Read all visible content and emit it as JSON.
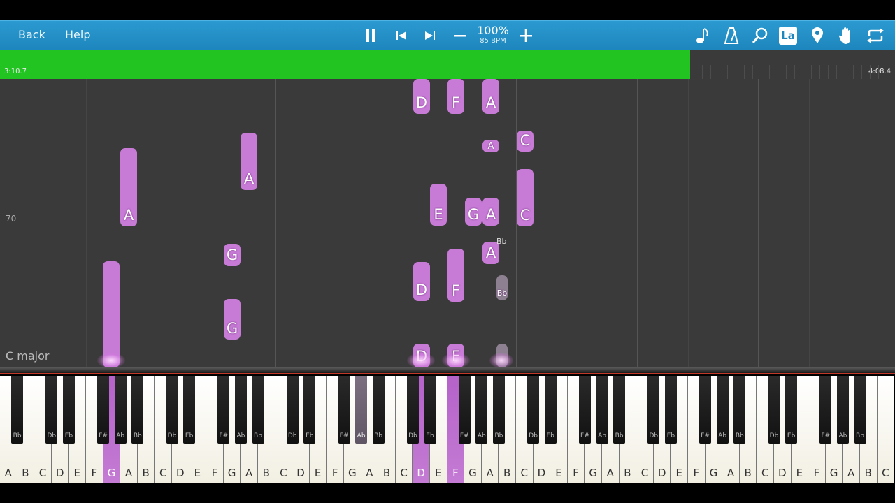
{
  "toolbar": {
    "back_label": "Back",
    "help_label": "Help",
    "speed_percent": "100%",
    "bpm": "85 BPM",
    "icons": [
      "pause-icon",
      "previous-icon",
      "next-icon",
      "minus-icon",
      "plus-icon",
      "music-note-icon",
      "metronome-icon",
      "search-icon",
      "label-icon",
      "location-pin-icon",
      "hand-icon",
      "loop-icon"
    ],
    "label_icon_text": "La"
  },
  "progress": {
    "current_time": "3:10.7",
    "total_time": "4:08.4",
    "fraction": 0.771,
    "fill_color": "#22c422"
  },
  "roll": {
    "measure_label": "70",
    "key_signature": "C major",
    "note_color": "#c77bd6",
    "notes": [
      "D",
      "F",
      "A",
      "C",
      "A",
      "A",
      "E",
      "G",
      "A",
      "C",
      "A",
      "G",
      "A",
      "Bb",
      "D",
      "F",
      "Bb",
      "G",
      "D",
      "F"
    ]
  },
  "keyboard": {
    "white_keys": [
      "A",
      "B",
      "C",
      "D",
      "E",
      "F",
      "G",
      "A",
      "B",
      "C",
      "D",
      "E",
      "F",
      "G",
      "A",
      "B",
      "C",
      "D",
      "E",
      "F",
      "G",
      "A",
      "B",
      "C",
      "D",
      "E",
      "F",
      "G",
      "A",
      "B",
      "C",
      "D",
      "E",
      "F",
      "G",
      "A",
      "B",
      "C",
      "D",
      "E",
      "F",
      "G",
      "A",
      "B",
      "C",
      "D",
      "E",
      "F",
      "G",
      "A",
      "B",
      "C"
    ],
    "black_keys": [
      "Bb",
      "Db",
      "Eb",
      "F#",
      "Ab",
      "Bb",
      "Db",
      "Eb",
      "F#",
      "Ab",
      "Bb",
      "Db",
      "Eb",
      "F#",
      "Ab",
      "Bb",
      "Db",
      "Eb",
      "F#",
      "Ab",
      "Bb",
      "Db",
      "Eb",
      "F#",
      "Ab",
      "Bb",
      "Db",
      "Eb",
      "F#",
      "Ab",
      "Bb",
      "Db",
      "Eb",
      "F#",
      "Ab",
      "Bb"
    ]
  }
}
